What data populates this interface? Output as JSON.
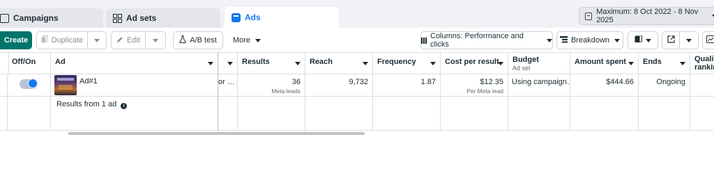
{
  "tabs": {
    "campaigns": "Campaigns",
    "ad_sets": "Ad sets",
    "ads": "Ads"
  },
  "date_range": "Maximum: 8 Oct 2022 - 8 Nov 2025",
  "toolbar": {
    "create": "Create",
    "duplicate": "Duplicate",
    "edit": "Edit",
    "ab_test": "A/B test",
    "more": "More",
    "columns": "Columns: Performance and clicks",
    "breakdown": "Breakdown"
  },
  "columns": {
    "off_on": "Off/On",
    "ad": "Ad",
    "results": "Results",
    "reach": "Reach",
    "frequency": "Frequency",
    "cost_per_result": "Cost per result",
    "budget": "Budget",
    "budget_sub": "Ad set",
    "amount_spent": "Amount spent",
    "ends": "Ends",
    "quality": "Quality ranking",
    "quality_line1": "Quali",
    "quality_line2": "rankin"
  },
  "rows": [
    {
      "ad_name": "Ad#1",
      "delivery": "or …",
      "results": "36",
      "results_sub": "Meta leads",
      "reach": "9,732",
      "frequency": "1.87",
      "cost_per_result": "$12.35",
      "cost_sub": "Per Meta lead",
      "budget": "Using campaign…",
      "amount_spent": "$444.66",
      "ends": "Ongoing",
      "active": true
    }
  ],
  "summary": "Results from 1 ad",
  "colors": {
    "accent": "#1877f2",
    "create_button": "#00756a",
    "tab_bg": "#e4e6eb"
  },
  "icons": [
    "campaigns-icon",
    "ad-sets-icon",
    "ads-icon",
    "calendar-icon",
    "duplicate-icon",
    "edit-icon",
    "flask-icon",
    "columns-icon",
    "breakdown-icon",
    "reports-icon",
    "export-icon",
    "chart-icon",
    "info-icon"
  ]
}
